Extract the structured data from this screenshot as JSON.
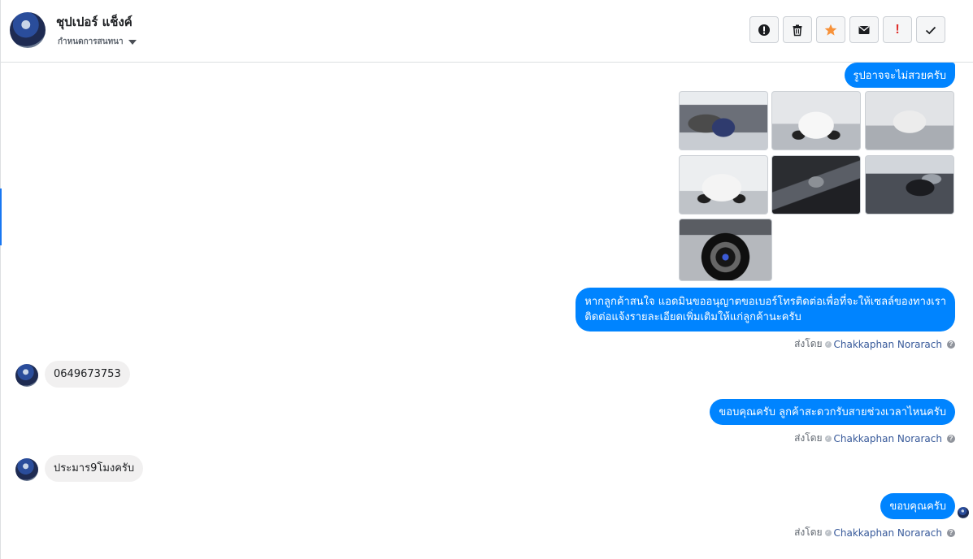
{
  "header": {
    "contact_name": "ชุปเปอร์ แช็งค์",
    "label_picker": "กำหนดการสนทนา",
    "actions": [
      {
        "name": "spam-report",
        "icon": "exclamation-circle-icon"
      },
      {
        "name": "delete",
        "icon": "trash-icon"
      },
      {
        "name": "star",
        "icon": "star-icon"
      },
      {
        "name": "mark-unread",
        "icon": "envelope-icon"
      },
      {
        "name": "follow-up",
        "icon": "exclamation-icon"
      },
      {
        "name": "mark-done",
        "icon": "checkmark-icon"
      }
    ]
  },
  "colors": {
    "outgoing_bubble": "#0084ff",
    "incoming_bubble": "#f1f0f0",
    "star": "#f7923a",
    "follow_up": "#e0302c",
    "sender_link": "#365899"
  },
  "conversation": {
    "msg_photos_caption": "รูปอาจจะไม่สวยครับ",
    "photos": [
      "engine-bay",
      "white-pickup-rear-quarter",
      "white-pickup-front",
      "white-pickup-side",
      "dashboard-interior",
      "cabin-interior",
      "wheel-closeup"
    ],
    "msg_request_number_line1": "หากลูกค้าสนใจ แอดมินขออนุญาตขอเบอร์โทรติดต่อเพื่อที่จะให้เซลล์ของทางเรา",
    "msg_request_number_line2": "ติดต่อแจ้งรายละเอียดเพิ่มเติมให้แก่ลูกค้านะครับ",
    "msg_phone": "0649673753",
    "msg_ask_time": "ขอบคุณครับ ลูกค้าสะดวกรับสายช่วงเวลาไหนครับ",
    "msg_time_reply": "ประมาร9โมงครับ",
    "msg_thanks": "ขอบคุณครับ",
    "sent_by_label": "ส่งโดย",
    "sender_name": "Chakkaphan Norarach",
    "help_glyph": "?"
  }
}
